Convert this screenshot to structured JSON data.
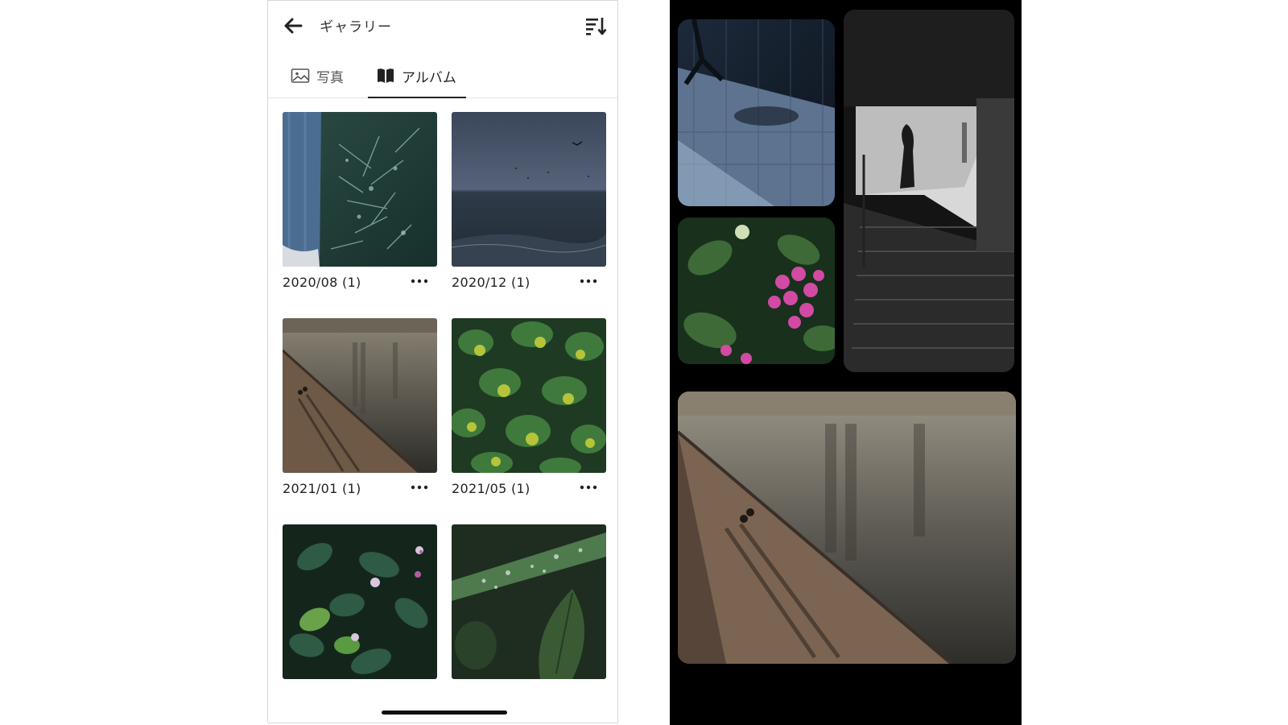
{
  "header": {
    "title": "ギャラリー"
  },
  "tabs": [
    {
      "label": "写真",
      "icon": "photo-icon",
      "active": false
    },
    {
      "label": "アルバム",
      "icon": "book-icon",
      "active": true
    }
  ],
  "albums": [
    {
      "label": "2020/08 (1)"
    },
    {
      "label": "2020/12 (1)"
    },
    {
      "label": "2021/01 (1)"
    },
    {
      "label": "2021/05 (1)"
    }
  ],
  "colors": {
    "accent": "#222222",
    "background": "#ffffff",
    "dark_background": "#000000"
  }
}
